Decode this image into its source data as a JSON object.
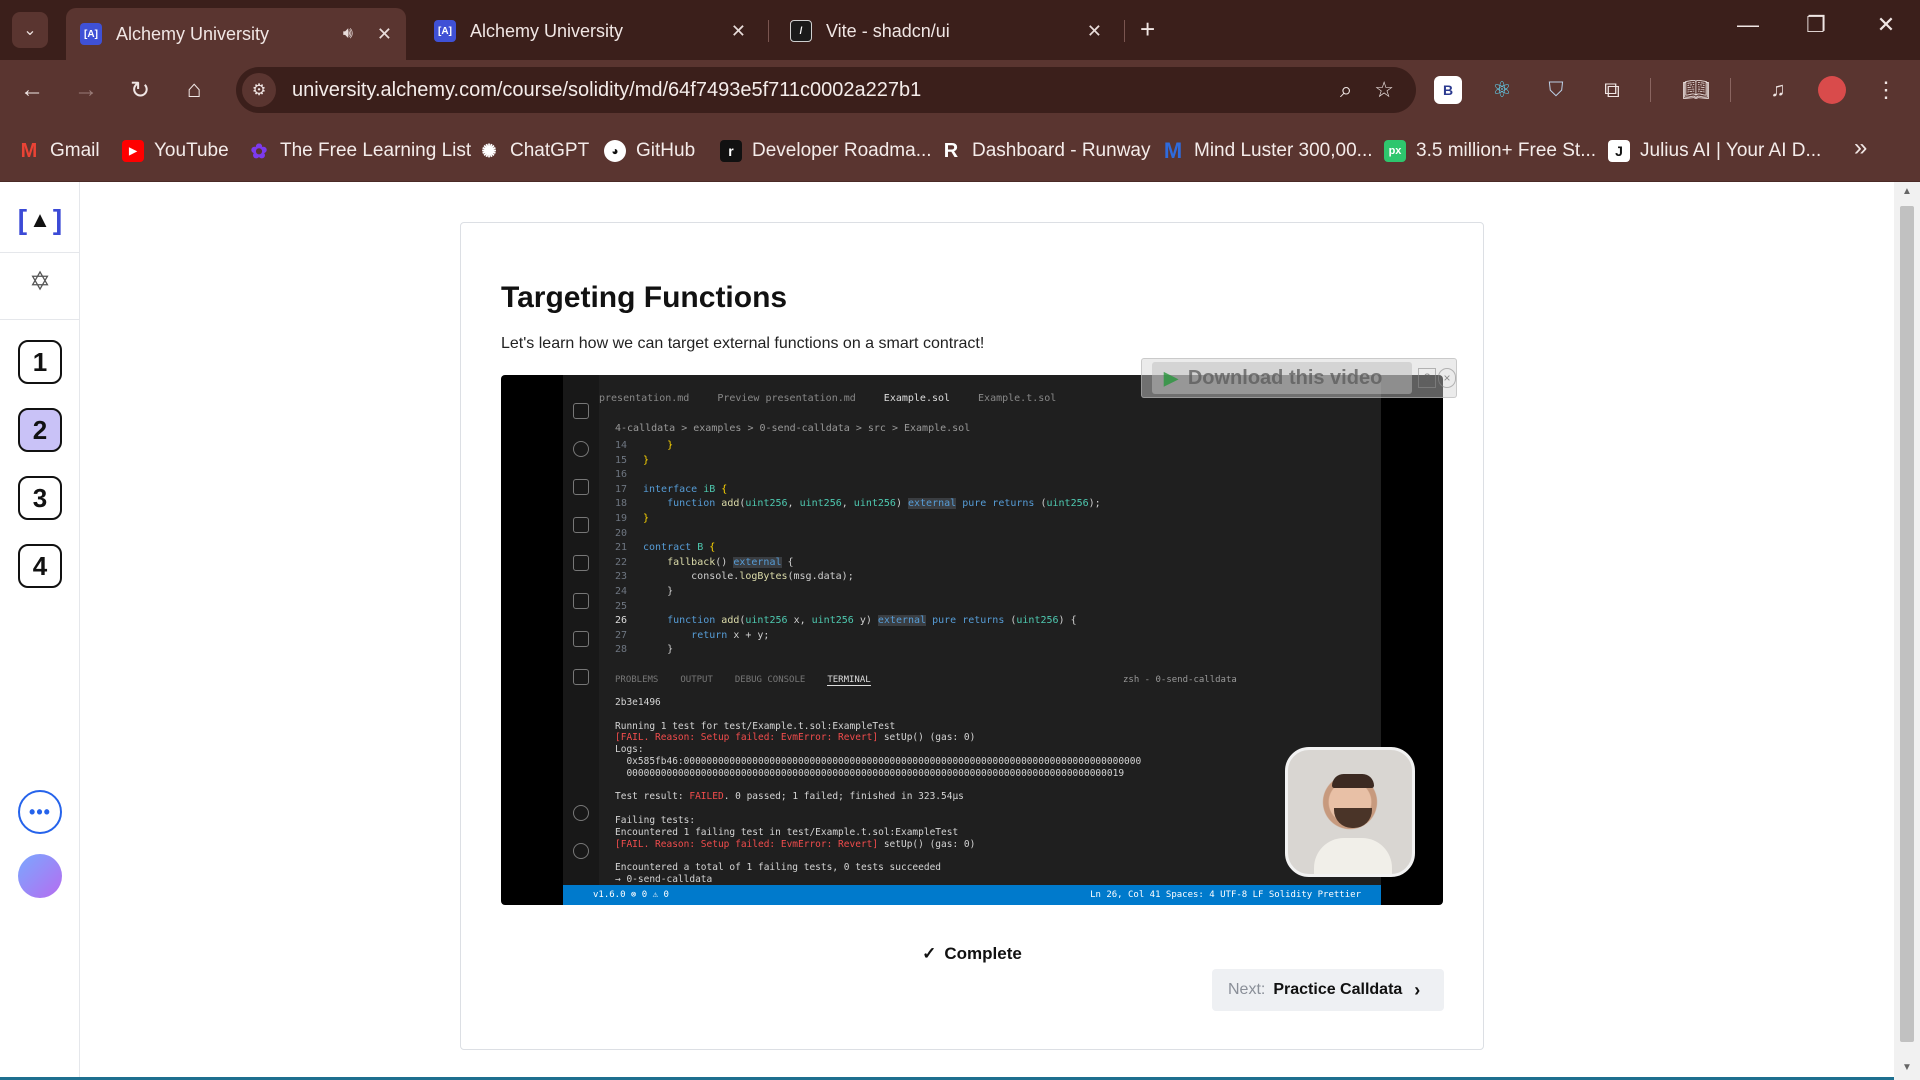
{
  "browser": {
    "tabs": [
      {
        "title": "Alchemy University",
        "favicon": "[A]",
        "active": true,
        "audio": true
      },
      {
        "title": "Alchemy University",
        "favicon": "[A]",
        "active": false,
        "audio": false
      },
      {
        "title": "Vite - shadcn/ui",
        "favicon": "/",
        "active": false,
        "audio": false
      }
    ],
    "url": "university.alchemy.com/course/solidity/md/64f7493e5f711c0002a227b1",
    "extensions": [
      {
        "name": "B",
        "icon": "b-extension-icon",
        "color": "#ffffff"
      },
      {
        "name": "",
        "icon": "react-icon",
        "color": "#61dafb"
      },
      {
        "name": "",
        "icon": "shield-extension-icon",
        "color": "#bcd0e6"
      }
    ],
    "bookmarks": [
      {
        "label": "Gmail",
        "icon": "gmail-icon",
        "color": "#ea4335"
      },
      {
        "label": "YouTube",
        "icon": "youtube-icon",
        "color": "#ff0000"
      },
      {
        "label": "The Free Learning List",
        "icon": "flower-icon",
        "color": "#7c3aed"
      },
      {
        "label": "ChatGPT",
        "icon": "chatgpt-icon",
        "color": "#ffffff"
      },
      {
        "label": "GitHub",
        "icon": "github-icon",
        "color": "#ffffff"
      },
      {
        "label": "Developer Roadma...",
        "icon": "roadmap-icon",
        "color": "#111111"
      },
      {
        "label": "Dashboard - Runway",
        "icon": "runway-icon",
        "color": "#ffffff"
      },
      {
        "label": "Mind Luster 300,00...",
        "icon": "mindluster-icon",
        "color": "#2f6bdc"
      },
      {
        "label": "3.5 million+ Free St...",
        "icon": "pixabay-icon",
        "color": "#2ec66d"
      },
      {
        "label": "Julius AI | Your AI D...",
        "icon": "julius-icon",
        "color": "#ffffff"
      }
    ]
  },
  "sidebar": {
    "steps": [
      "1",
      "2",
      "3",
      "4"
    ],
    "current_step": "2"
  },
  "lesson": {
    "title": "Targeting Functions",
    "description": "Let's learn how we can target external functions on a smart contract!",
    "download_label": "Download this video",
    "download_help": "?",
    "download_close": "×",
    "complete_label": "Complete",
    "next_label": "Next:",
    "next_title": "Practice Calldata"
  },
  "video": {
    "editor_tabs": [
      "presentation.md",
      "Preview presentation.md",
      "Example.sol",
      "Example.t.sol"
    ],
    "active_editor_tab": "Example.sol",
    "breadcrumb": "4-calldata > examples > 0-send-calldata > src > Example.sol",
    "panel_tabs": [
      "PROBLEMS",
      "OUTPUT",
      "DEBUG CONSOLE",
      "TERMINAL"
    ],
    "active_panel_tab": "TERMINAL",
    "panel_right": "zsh - 0-send-calldata",
    "status_left": "v1.6.0  ⊗ 0 ⚠ 0",
    "status_right": "Ln 26, Col 41   Spaces: 4   UTF-8   LF   Solidity   Prettier"
  },
  "colors": {
    "titlebar": "#3b1f1b",
    "toolbar": "#5a3530",
    "accent_blue": "#3b4ad6",
    "current_step": "#c9c2f7"
  }
}
